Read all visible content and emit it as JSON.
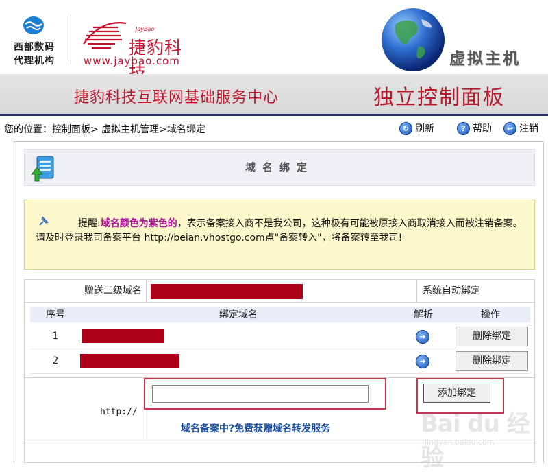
{
  "header": {
    "west_logo_line1": "西部数码",
    "west_logo_line2": "代理机构",
    "jaybao_tag": "JayBao",
    "jaybao_name": "捷豹科技",
    "jaybao_url": "www.jaybao.com",
    "vhost_title": "虚拟主机"
  },
  "banner": {
    "subtitle": "捷豹科技互联网基础服务中心",
    "title": "独立控制面板"
  },
  "breadcrumb": "您的位置：控制面板> 虚拟主机管理>域名绑定",
  "toplinks": {
    "refresh": "刷新",
    "help": "帮助",
    "logout": "注销"
  },
  "panel": {
    "title": "域名绑定"
  },
  "notice": {
    "lead": "提醒:",
    "highlight": "域名颜色为紫色的",
    "text": "，表示备案接入商不是我公司，这种极有可能被原接入商取消接入而被注销备案。请及时登录我司备案平台 http://beian.vhostgo.com点\"备案转入\"，将备案转至我司!"
  },
  "gift_row": {
    "label": "赠送二级域名",
    "status": "系统自动绑定"
  },
  "table": {
    "headers": [
      "序号",
      "绑定域名",
      "解析",
      "操作"
    ],
    "rows": [
      {
        "index": "1",
        "delete_label": "删除绑定"
      },
      {
        "index": "2",
        "delete_label": "删除绑定"
      }
    ]
  },
  "add": {
    "prefix": "http://",
    "input_value": "",
    "button_label": "添加绑定",
    "promo_link": "域名备案中?免费获赠域名转发服务"
  },
  "watermark": {
    "text": "Bai du 经验",
    "url": "jingyan.baidu.com"
  },
  "colors": {
    "brand_red": "#c8102e",
    "redaction": "#b00019",
    "banner_border": "#2a2e78",
    "notice_bg": "#fdf8cc",
    "highlight_purple": "#b0119c",
    "link_blue": "#1b4fa0"
  }
}
